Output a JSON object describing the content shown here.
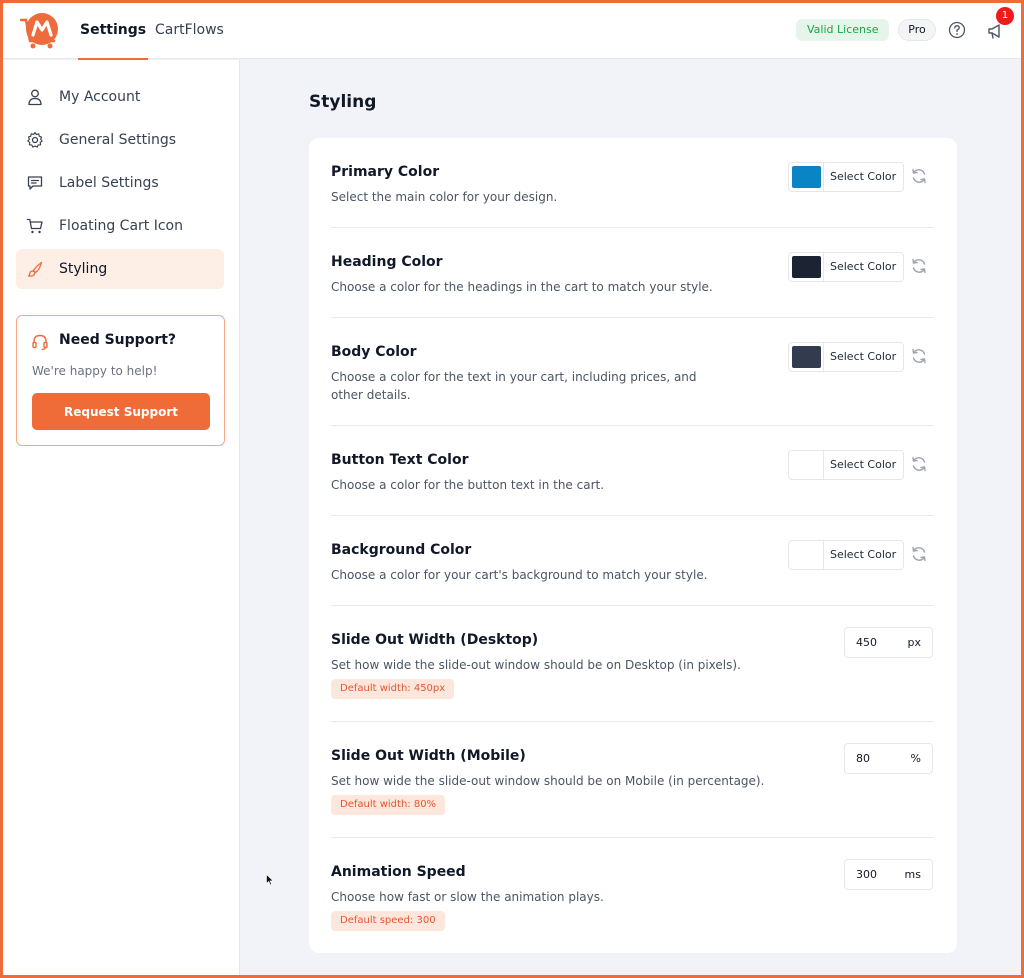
{
  "header": {
    "tabs": [
      "Settings",
      "CartFlows"
    ],
    "license": "Valid License",
    "plan": "Pro",
    "notifications": "1",
    "accent_color": "#ee6b3b"
  },
  "sidebar": {
    "items": [
      {
        "label": "My Account",
        "icon": "user-icon"
      },
      {
        "label": "General Settings",
        "icon": "gear-icon"
      },
      {
        "label": "Label Settings",
        "icon": "message-icon"
      },
      {
        "label": "Floating Cart Icon",
        "icon": "cart-icon"
      },
      {
        "label": "Styling",
        "icon": "brush-icon",
        "active": true
      }
    ],
    "support": {
      "title": "Need Support?",
      "subtitle": "We're happy to help!",
      "button": "Request Support"
    }
  },
  "main": {
    "title": "Styling",
    "select_color_label": "Select Color",
    "colors": [
      {
        "label": "Primary Color",
        "desc": "Select the main color for your design.",
        "value": "#0b84c6"
      },
      {
        "label": "Heading Color",
        "desc": "Choose a color for the headings in the cart to match your style.",
        "value": "#1c2434"
      },
      {
        "label": "Body Color",
        "desc": "Choose a color for the text in your cart, including prices, and other details.",
        "value": "#323c4e"
      },
      {
        "label": "Button Text Color",
        "desc": "Choose a color for the button text in the cart.",
        "value": "#ffffff"
      },
      {
        "label": "Background Color",
        "desc": "Choose a color for your cart's background to match your style.",
        "value": "#ffffff"
      }
    ],
    "numbers": [
      {
        "label": "Slide Out Width (Desktop)",
        "desc": "Set how wide the slide-out window should be on Desktop (in pixels).",
        "hint": "Default width: 450px",
        "value": "450",
        "unit": "px"
      },
      {
        "label": "Slide Out Width (Mobile)",
        "desc": "Set how wide the slide-out window should be on Mobile (in percentage).",
        "hint": "Default width: 80%",
        "value": "80",
        "unit": "%"
      },
      {
        "label": "Animation Speed",
        "desc": "Choose how fast or slow the animation plays.",
        "hint": "Default speed: 300",
        "value": "300",
        "unit": "ms"
      }
    ]
  }
}
